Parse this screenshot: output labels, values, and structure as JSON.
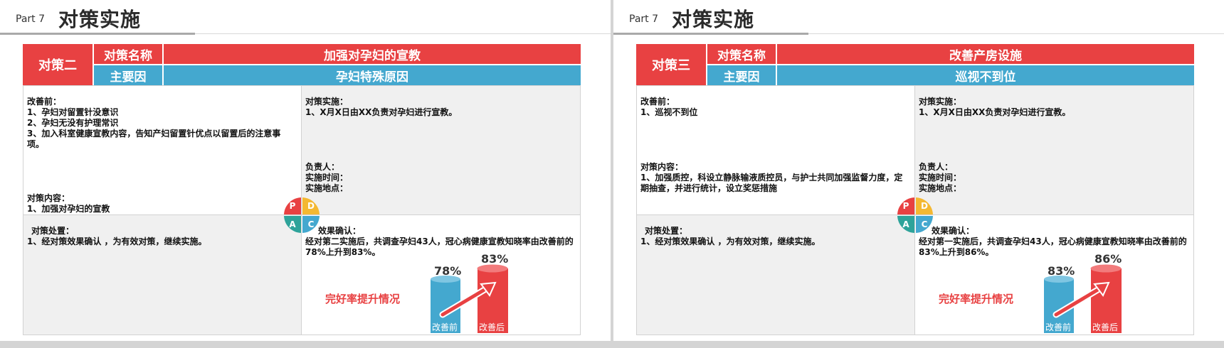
{
  "slides": [
    {
      "part": "Part 7",
      "title": "对策实施",
      "strategy_label": "对策二",
      "name_label": "对策名称",
      "name_value": "加强对孕妇的宣教",
      "cause_label": "主要因",
      "cause_value": "孕妇特殊原因",
      "before_lines": [
        "改善前：",
        "1、孕妇对留置针没意识",
        "2、孕妇无没有护理常识",
        "3、加入科室健康宣教内容，告知产妇留置针优点以留置后的注意事项。"
      ],
      "content_lines": [
        "对策内容：",
        "1、加强对孕妇的宣教"
      ],
      "impl_lines": [
        "对策实施：",
        "1、X月X日由XX负责对孕妇进行宣教。"
      ],
      "owner_lines": [
        "负责人：",
        "实施时间：",
        "实施地点："
      ],
      "handling_lines": [
        "对策处置：",
        "1、经对策效果确认 ，为有效对策，继续实施。"
      ],
      "effect_lines": [
        "效果确认：",
        "经对第二实施后，共调查孕妇43人，冠心病健康宣教知晓率由改善前的78%上升到83%。"
      ],
      "pdca": {
        "p": "P",
        "d": "D",
        "a": "A",
        "c": "C"
      },
      "rate_title": "完好率提升情况",
      "before_pct": "78%",
      "after_pct": "83%",
      "before_bar_label": "改善前",
      "after_bar_label": "改善后"
    },
    {
      "part": "Part 7",
      "title": "对策实施",
      "strategy_label": "对策三",
      "name_label": "对策名称",
      "name_value": "改善产房设施",
      "cause_label": "主要因",
      "cause_value": "巡视不到位",
      "before_lines": [
        "改善前：",
        "1、巡视不到位"
      ],
      "content_lines": [
        "对策内容：",
        "1、加强质控，科设立静脉输液质控员，与护士共同加强监督力度，定期抽查，并进行统计，设立奖惩措施"
      ],
      "impl_lines": [
        "对策实施：",
        "1、X月X日由XX负责对孕妇进行宣教。"
      ],
      "owner_lines": [
        "负责人：",
        "实施时间：",
        "实施地点："
      ],
      "handling_lines": [
        "对策处置：",
        "1、经对策效果确认 ，为有效对策，继续实施。"
      ],
      "effect_lines": [
        "效果确认：",
        "经对第一实施后，共调查孕妇43人，冠心病健康宣教知晓率由改善前的83%上升到86%。"
      ],
      "pdca": {
        "p": "P",
        "d": "D",
        "a": "A",
        "c": "C"
      },
      "rate_title": "完好率提升情况",
      "before_pct": "83%",
      "after_pct": "86%",
      "before_bar_label": "改善前",
      "after_bar_label": "改善后"
    }
  ],
  "colors": {
    "red": "#e84142",
    "blue": "#44a8cf",
    "yellow": "#f4b832",
    "teal": "#2ea39a",
    "cell_gray": "#f0f0f0"
  }
}
